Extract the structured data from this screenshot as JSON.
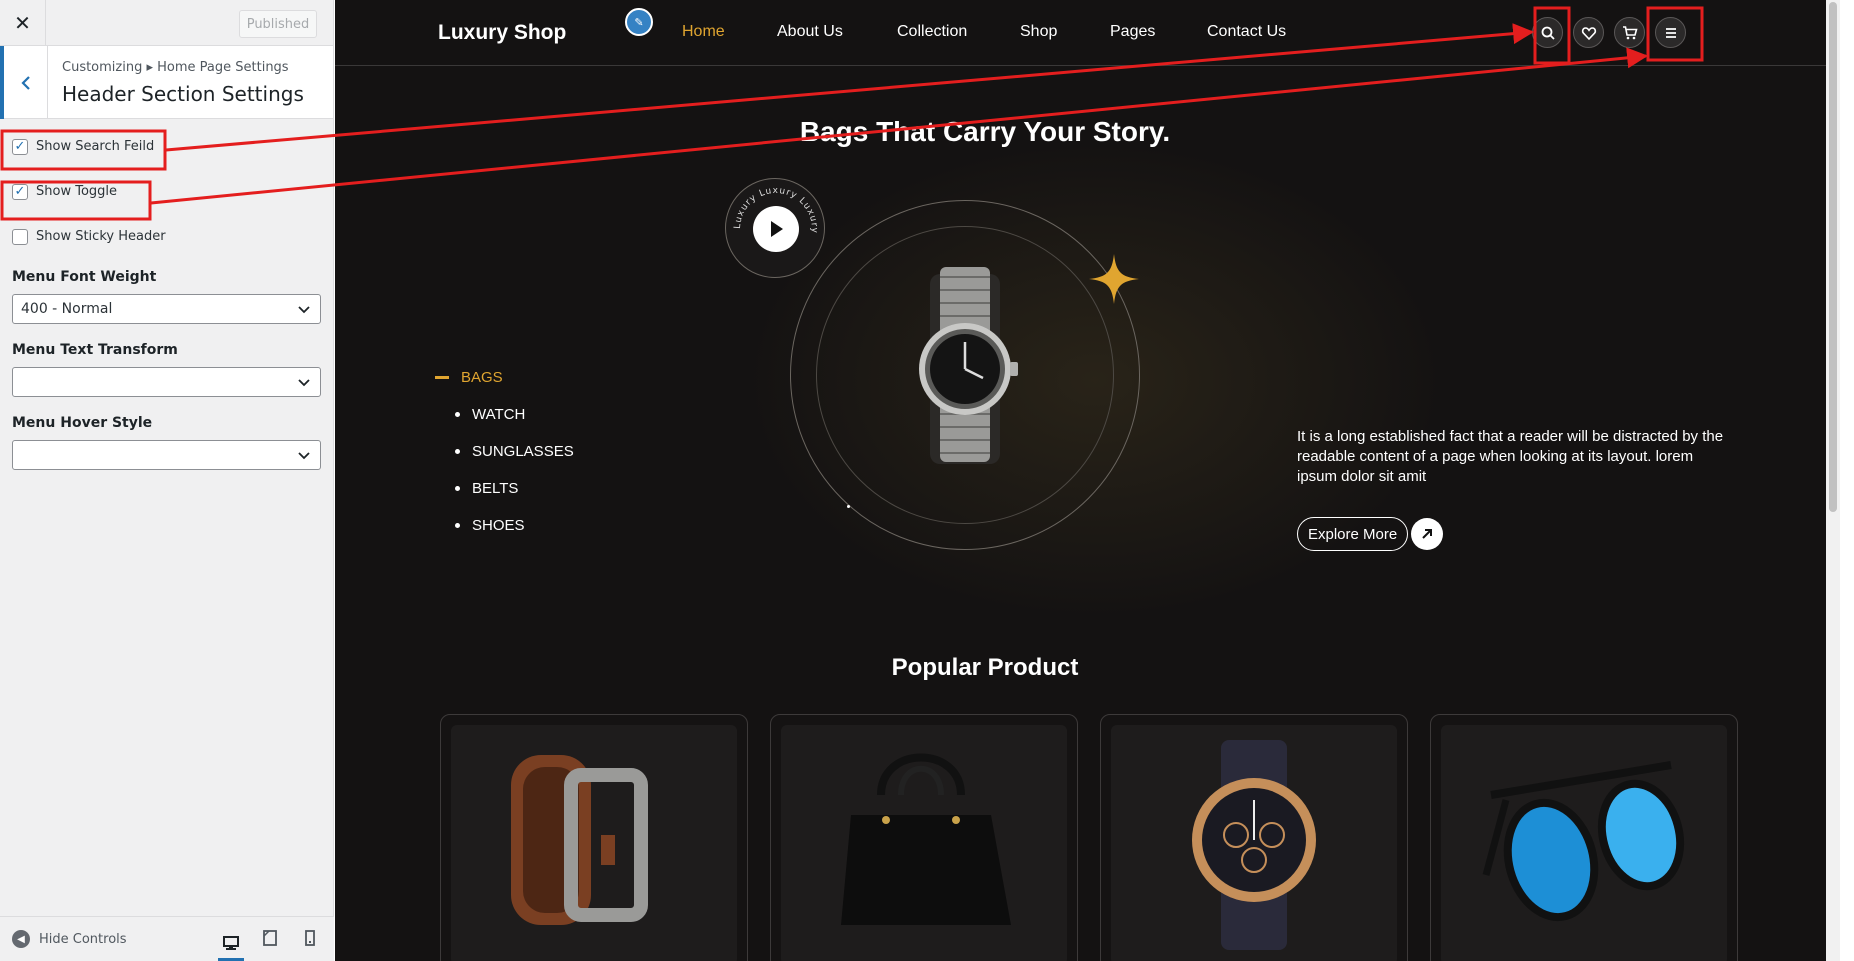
{
  "sidebar": {
    "close_glyph": "✕",
    "publish_label": "Published",
    "breadcrumb": "Customizing ▸ Home Page Settings",
    "section_title": "Header Section Settings",
    "checkboxes": [
      {
        "label": "Show Search Feild",
        "checked": true
      },
      {
        "label": "Show Toggle",
        "checked": true
      },
      {
        "label": "Show Sticky Header",
        "checked": false
      }
    ],
    "font_weight": {
      "label": "Menu Font Weight",
      "value": "400 - Normal"
    },
    "text_transform": {
      "label": "Menu Text Transform",
      "value": ""
    },
    "hover_style": {
      "label": "Menu Hover Style",
      "value": ""
    },
    "footer": {
      "hide_label": "Hide Controls"
    }
  },
  "site": {
    "brand": "Luxury Shop",
    "nav": [
      "Home",
      "About Us",
      "Collection",
      "Shop",
      "Pages",
      "Contact Us"
    ],
    "active_nav": "Home",
    "hero_title": "Bags That Carry Your Story.",
    "badge_text": "Luxury Luxury Luxury",
    "categories": [
      "BAGS",
      "WATCH",
      "SUNGLASSES",
      "BELTS",
      "SHOES"
    ],
    "active_category": "BAGS",
    "description": "It is a long established fact that a reader will be distracted by the readable content of a page when looking at its layout. lorem ipsum dolor sit amit",
    "explore_label": "Explore More",
    "popular_title": "Popular Product",
    "products": [
      {
        "icon": "belt-image"
      },
      {
        "icon": "handbag-image"
      },
      {
        "icon": "chronograph-watch-image"
      },
      {
        "icon": "sunglasses-image"
      }
    ]
  },
  "colors": {
    "accent": "#e0a530",
    "wp_blue": "#2271b1",
    "annotation_red": "#e41e1e",
    "preview_bg": "#141212"
  }
}
